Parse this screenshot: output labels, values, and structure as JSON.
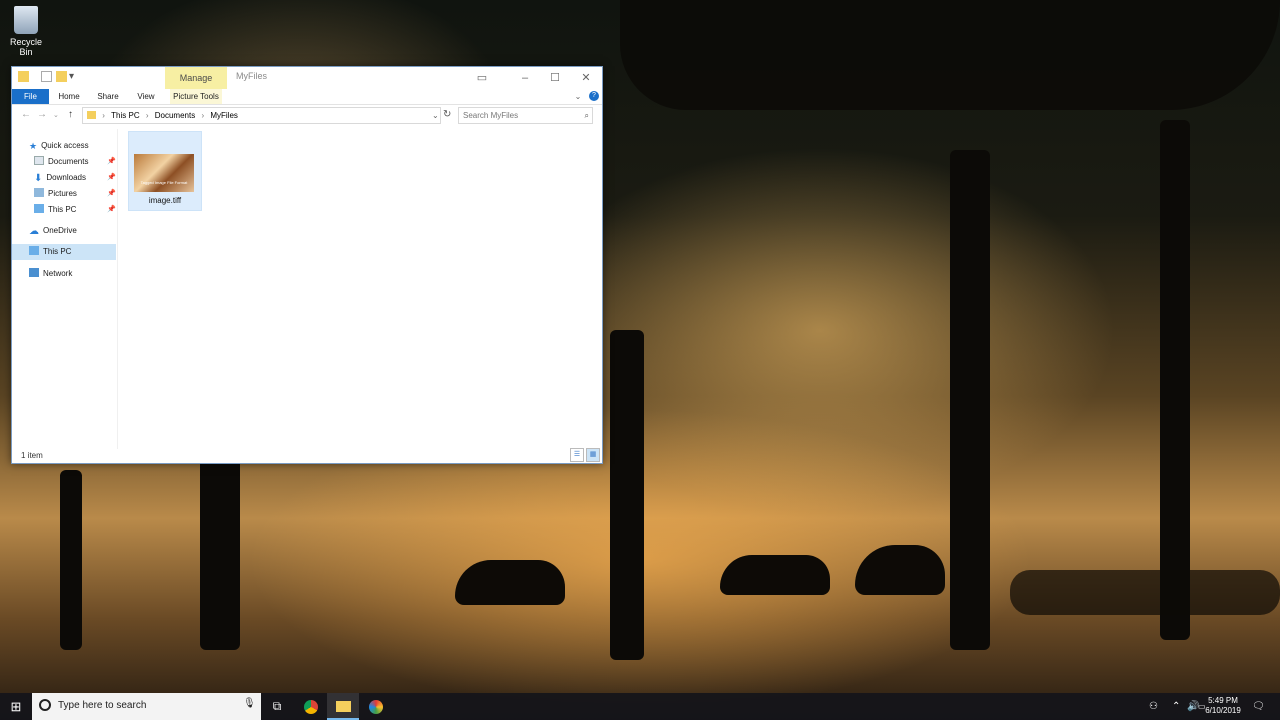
{
  "desktop": {
    "icons": [
      {
        "label": "Recycle Bin",
        "icon": "recycle-bin-icon"
      }
    ]
  },
  "explorer": {
    "title": "MyFiles",
    "contextual_tab_label": "Manage",
    "ribbon_tabs": [
      {
        "label": "File"
      },
      {
        "label": "Home"
      },
      {
        "label": "Share"
      },
      {
        "label": "View"
      },
      {
        "label": "Picture Tools"
      }
    ],
    "breadcrumb": [
      "This PC",
      "Documents",
      "MyFiles"
    ],
    "search_placeholder": "Search MyFiles",
    "nav": {
      "quick_access": "Quick access",
      "quick_items": [
        {
          "label": "Documents",
          "icon": "documents-folder-icon",
          "pinned": true
        },
        {
          "label": "Downloads",
          "icon": "downloads-folder-icon",
          "pinned": true
        },
        {
          "label": "Pictures",
          "icon": "pictures-folder-icon",
          "pinned": true
        },
        {
          "label": "This PC",
          "icon": "computer-icon",
          "pinned": true
        }
      ],
      "onedrive": "OneDrive",
      "this_pc": "This PC",
      "network": "Network"
    },
    "files": [
      {
        "name": "image.tiff",
        "thumbnail_caption": "Tagged Image File Format"
      }
    ],
    "status_text": "1 item",
    "accent_color": "#1a6fc9"
  },
  "taskbar": {
    "search_placeholder": "Type here to search",
    "clock_time": "5:49 PM",
    "clock_date": "6/10/2019"
  }
}
